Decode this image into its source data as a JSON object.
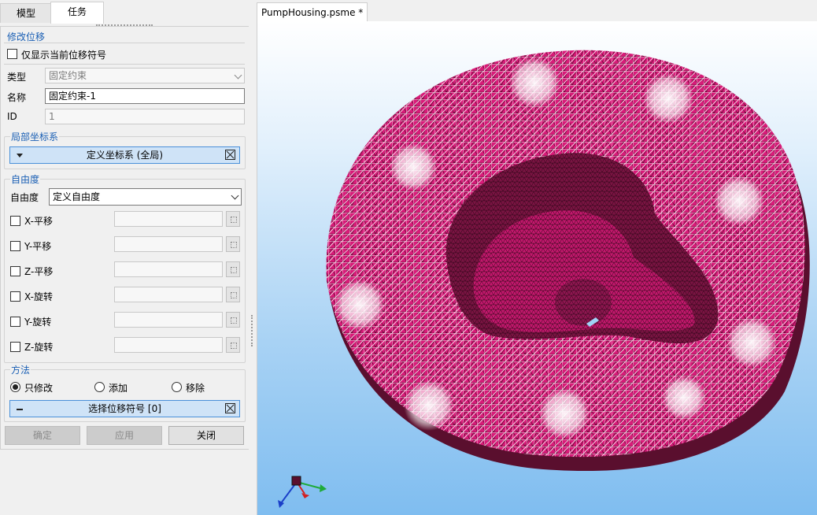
{
  "tabs": {
    "model": "模型",
    "task": "任务"
  },
  "modify_section": {
    "title": "修改位移",
    "show_current_label": "仅显示当前位移符号",
    "show_current_checked": false,
    "type_label": "类型",
    "type_value": "固定约束",
    "name_label": "名称",
    "name_value": "固定约束-1",
    "id_label": "ID",
    "id_value": "1"
  },
  "local_cs_section": {
    "title": "局部坐标系",
    "define_button": "定义坐标系 (全局)"
  },
  "dof_section": {
    "title": "自由度",
    "dof_label": "自由度",
    "dof_value": "定义自由度",
    "items": [
      {
        "label": "X-平移",
        "checked": false,
        "value": ""
      },
      {
        "label": "Y-平移",
        "checked": false,
        "value": ""
      },
      {
        "label": "Z-平移",
        "checked": false,
        "value": ""
      },
      {
        "label": "X-旋转",
        "checked": false,
        "value": ""
      },
      {
        "label": "Y-旋转",
        "checked": false,
        "value": ""
      },
      {
        "label": "Z-旋转",
        "checked": false,
        "value": ""
      }
    ]
  },
  "method_section": {
    "title": "方法",
    "options": [
      {
        "label": "只修改",
        "selected": true
      },
      {
        "label": "添加",
        "selected": false
      },
      {
        "label": "移除",
        "selected": false
      }
    ],
    "select_button": "选择位移符号 [0]"
  },
  "buttons": {
    "ok": "确定",
    "apply": "应用",
    "close": "关闭"
  },
  "document": {
    "tab_title": "PumpHousing.psme *"
  },
  "colors": {
    "mesh": "#d81b79",
    "mesh_lines": "#3a0a20",
    "section_title": "#1a5fb4",
    "viewport_top": "#ffffff",
    "viewport_bottom": "#7fbdf0",
    "axis_x": "#1faa3a",
    "axis_y": "#d32020",
    "axis_z": "#1a3fc8"
  },
  "icons": {
    "collapse": "triangle-down-icon",
    "clear": "x-box-icon",
    "pick": "pick-icon",
    "minus": "minus-icon",
    "triad": "axis-triad-icon"
  }
}
